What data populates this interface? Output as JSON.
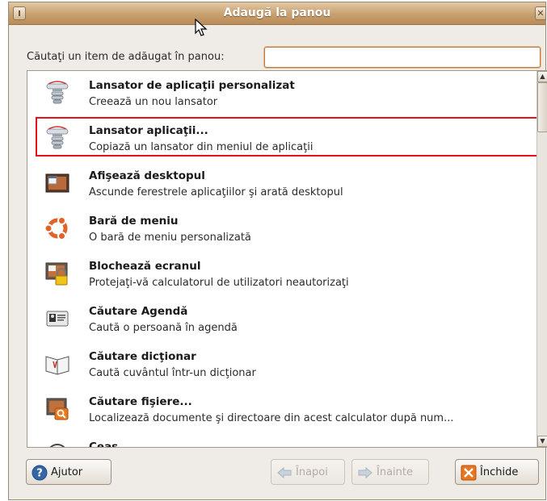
{
  "window": {
    "title": "Adaugă la panou"
  },
  "search": {
    "label": "Căutaţi un item de adăugat în panou:",
    "value": "",
    "placeholder": ""
  },
  "items": [
    {
      "name": "Lansator de aplicaţii personalizat",
      "description": "Creează un nou lansator",
      "icon": "launcher-icon"
    },
    {
      "name": "Lansator aplicaţii...",
      "description": "Copiază un lansator din meniul de aplicaţii",
      "icon": "launcher-icon"
    },
    {
      "name": "Afişează desktopul",
      "description": "Ascunde ferestrele aplicaţiilor şi arată desktopul",
      "icon": "show-desktop-icon"
    },
    {
      "name": "Bară de meniu",
      "description": "O bară de meniu personalizată",
      "icon": "ubuntu-logo-icon"
    },
    {
      "name": "Blochează ecranul",
      "description": "Protejaţi-vă calculatorul de utilizatori neautorizaţi",
      "icon": "lock-screen-icon"
    },
    {
      "name": "Căutare Agendă",
      "description": "Caută o persoană în agendă",
      "icon": "address-book-icon"
    },
    {
      "name": "Căutare dicţionar",
      "description": "Caută cuvântul într-un dicţionar",
      "icon": "dictionary-icon"
    },
    {
      "name": "Căutare fişiere...",
      "description": "Localizează documente şi directoare din acest calculator după num...",
      "icon": "search-files-icon"
    },
    {
      "name": "Ceas",
      "description": "",
      "icon": "clock-icon"
    }
  ],
  "buttons": {
    "help": "Ajutor",
    "back": "Înapoi",
    "next": "Înainte",
    "close": "Închide"
  },
  "colors": {
    "highlight": "#e4121c",
    "titlebar": "#c8a070"
  }
}
